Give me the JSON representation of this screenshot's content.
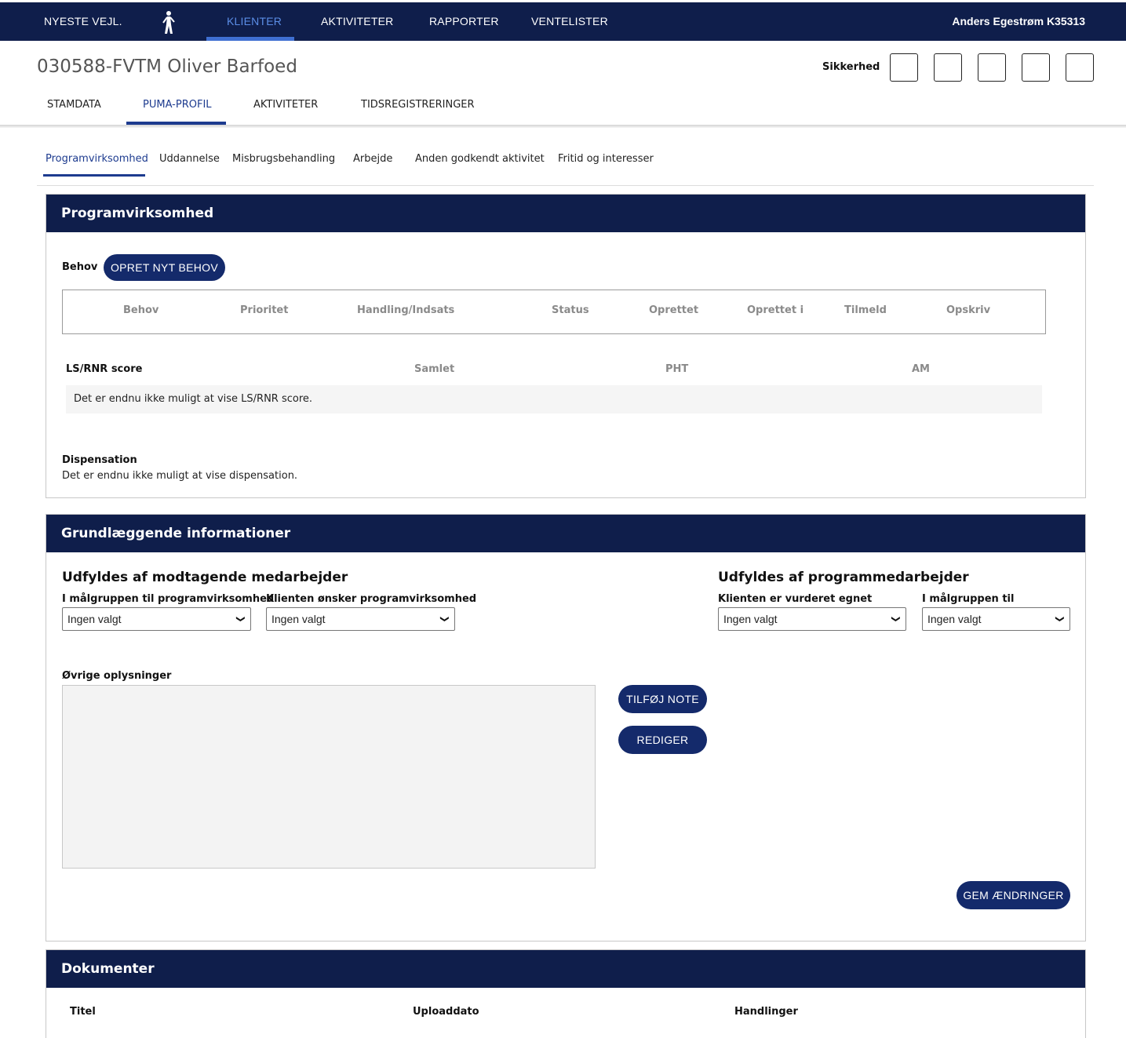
{
  "topnav": {
    "items": [
      "NYESTE VEJL.",
      "KLIENTER",
      "AKTIVITETER",
      "RAPPORTER",
      "VENTELISTER"
    ],
    "active": "KLIENTER",
    "user": "Anders Egestrøm K35313",
    "logo_icon": "walking-figure-icon"
  },
  "client": {
    "title": "030588-FVTM Oliver Barfoed"
  },
  "security": {
    "label": "Sikkerhed",
    "boxes": 5
  },
  "client_tabs": [
    "STAMDATA",
    "PUMA-PROFIL",
    "AKTIVITETER",
    "TIDSREGISTRERINGER"
  ],
  "profile_tabs": [
    "Programvirksomhed",
    "Uddannelse",
    "Misbrugsbehandling",
    "Arbejde",
    "Anden godkendt aktivitet",
    "Fritid og interesser"
  ],
  "program": {
    "title": "Programvirksomhed",
    "behov_label": "Behov",
    "create_button": "OPRET NYT BEHOV",
    "table_headers": [
      "Behov",
      "Prioritet",
      "Handling/Indsats",
      "Status",
      "Oprettet",
      "Oprettet i",
      "Tilmeld",
      "Opskriv"
    ],
    "score_title": "LS/RNR score",
    "score_headers": [
      "Samlet",
      "PHT",
      "AM"
    ],
    "score_empty": "Det er endnu ikke muligt at vise LS/RNR score.",
    "dispensation_label": "Dispensation",
    "dispensation_text": "Det er endnu ikke muligt at vise dispensation."
  },
  "basic": {
    "title": "Grundlæggende informationer",
    "left_heading": "Udfyldes af modtagende medarbejder",
    "right_heading": "Udfyldes af programmedarbejder",
    "fields": [
      {
        "label": "I målgruppen til programvirksomhed",
        "value": "Ingen valgt"
      },
      {
        "label": "Klienten ønsker programvirksomhed",
        "value": "Ingen valgt"
      },
      {
        "label": "Klienten er vurderet egnet",
        "value": "Ingen valgt"
      },
      {
        "label": "I målgruppen til programmer",
        "value": "Ingen valgt"
      }
    ],
    "notes_label": "Øvrige oplysninger",
    "add_note_button": "TILFØJ NOTE",
    "edit_button": "REDIGER",
    "save_button": "GEM ÆNDRINGER"
  },
  "documents": {
    "title": "Dokumenter",
    "headers": [
      "Titel",
      "Uploaddato",
      "Handlinger"
    ]
  },
  "colors": {
    "navy": "#0f1e4b",
    "button": "#142a6b",
    "active_link": "#1d3b8f",
    "nav_active": "#5b8de6"
  }
}
